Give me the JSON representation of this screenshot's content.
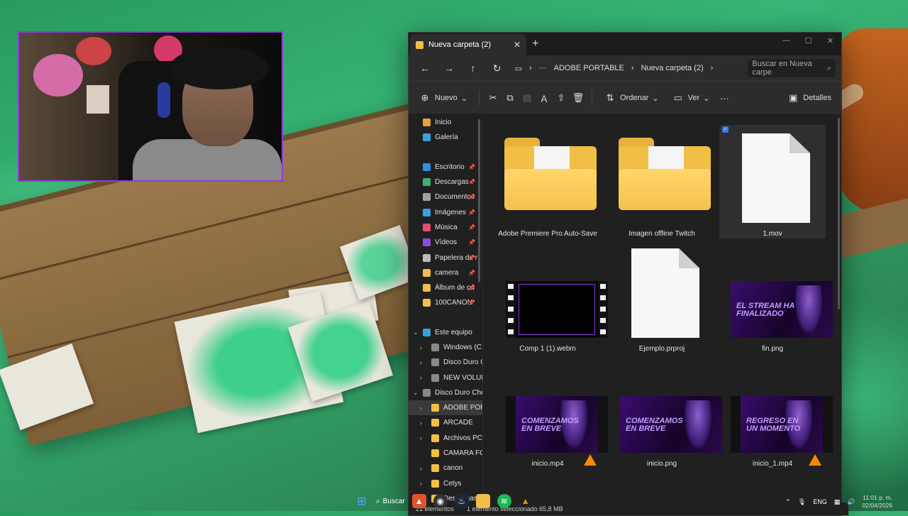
{
  "explorer": {
    "tab_title": "Nueva carpeta (2)",
    "breadcrumb": [
      "ADOBE PORTABLE",
      "Nueva carpeta (2)"
    ],
    "search_placeholder": "Buscar en Nueva carpe",
    "toolbar": {
      "new_label": "Nuevo",
      "sort_label": "Ordenar",
      "view_label": "Ver",
      "details_label": "Detalles"
    },
    "sidebar": {
      "quick": [
        {
          "label": "Inicio",
          "color": "#e8a040"
        },
        {
          "label": "Galería",
          "color": "#3aa0e0"
        }
      ],
      "pinned": [
        {
          "label": "Escritorio",
          "color": "#2f8fe0"
        },
        {
          "label": "Descargas",
          "color": "#3cb371"
        },
        {
          "label": "Documentos",
          "color": "#a0a0a0"
        },
        {
          "label": "Imágenes",
          "color": "#3aa0e0"
        },
        {
          "label": "Música",
          "color": "#e0506a"
        },
        {
          "label": "Vídeos",
          "color": "#8a4fe0"
        },
        {
          "label": "Papelera de r",
          "color": "#bbbbbb"
        },
        {
          "label": "camera",
          "color": "#f1be46"
        },
        {
          "label": "Álbum de cá",
          "color": "#f1be46"
        },
        {
          "label": "100CANON",
          "color": "#f1be46"
        }
      ],
      "tree": [
        {
          "label": "Este equipo",
          "color": "#3aa0e0",
          "chev": "v",
          "indent": 0
        },
        {
          "label": "Windows (C:)",
          "color": "#888888",
          "chev": ">",
          "indent": 1
        },
        {
          "label": "Disco Duro Ch",
          "color": "#888888",
          "chev": ">",
          "indent": 1
        },
        {
          "label": "NEW VOLUME",
          "color": "#888888",
          "chev": ">",
          "indent": 1
        },
        {
          "label": "Disco Duro Che",
          "color": "#888888",
          "chev": "v",
          "indent": 0
        },
        {
          "label": "ADOBE PORTA",
          "color": "#f1be46",
          "chev": ">",
          "indent": 1,
          "selected": true
        },
        {
          "label": "ARCADE",
          "color": "#f1be46",
          "chev": ">",
          "indent": 1
        },
        {
          "label": "Archivos PC",
          "color": "#f1be46",
          "chev": ">",
          "indent": 1
        },
        {
          "label": "CAMARA FOTO",
          "color": "#f1be46",
          "chev": "",
          "indent": 1
        },
        {
          "label": "canon",
          "color": "#f1be46",
          "chev": ">",
          "indent": 1
        },
        {
          "label": "Cetys",
          "color": "#f1be46",
          "chev": ">",
          "indent": 1
        },
        {
          "label": "Descargas",
          "color": "#f1be46",
          "chev": ">",
          "indent": 1
        }
      ]
    },
    "files": [
      {
        "name": "Adobe Premiere Pro Auto-Save",
        "kind": "folder"
      },
      {
        "name": "Imagen offline Twitch",
        "kind": "folder"
      },
      {
        "name": "1.mov",
        "kind": "file",
        "selected": true
      },
      {
        "name": "Comp 1 (1).webm",
        "kind": "film"
      },
      {
        "name": "Ejemplo.prproj",
        "kind": "file"
      },
      {
        "name": "fin.png",
        "kind": "promo",
        "promo_text": "EL STREAM HA\nFINALIZADO"
      },
      {
        "name": "inicio.mp4",
        "kind": "film-promo",
        "promo_text": "COMENZAMOS\nEN BREVE",
        "vlc": true
      },
      {
        "name": "inicio.png",
        "kind": "promo",
        "promo_text": "COMENZAMOS\nEN BREVE"
      },
      {
        "name": "inicio_1.mp4",
        "kind": "film-promo",
        "promo_text": "REGRESO EN\nUN MOMENTO",
        "vlc": true
      }
    ],
    "status": {
      "count": "21 elementos",
      "selection": "1 elemento seleccionado  65,8 MB"
    }
  },
  "taskbar": {
    "search_label": "Buscar",
    "lang": "ENG",
    "time": "11:01 p. m.",
    "date": "02/04/2026"
  }
}
